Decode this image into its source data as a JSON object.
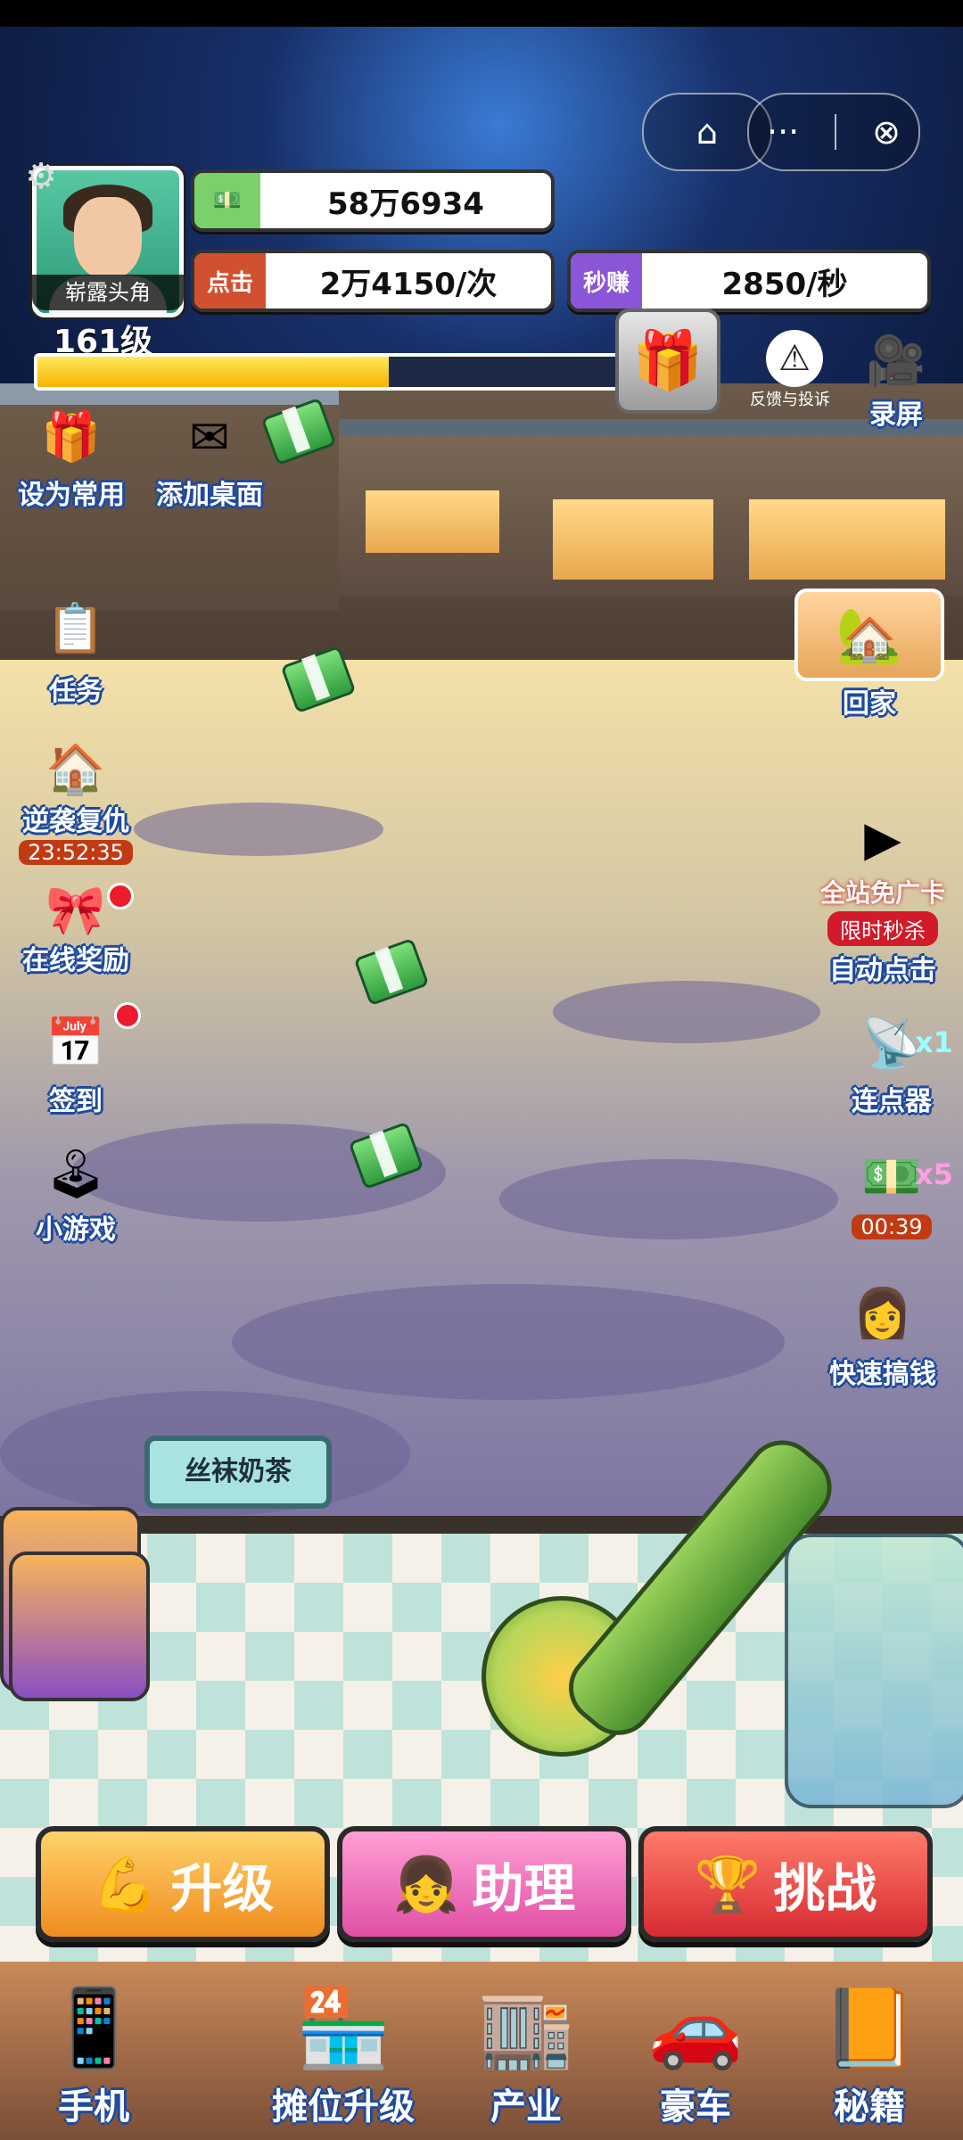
{
  "header": {
    "home_icon": "home-icon",
    "more_icon": "more-icon",
    "close_icon": "close-icon"
  },
  "player": {
    "name": "崭露头角",
    "cash": "58万6934",
    "click_tag": "点击",
    "click_value": "2万4150/次",
    "second_tag": "秒赚",
    "second_value": "2850/秒",
    "level": "161级",
    "level_progress": 0.58
  },
  "tools": {
    "feedback": "反馈与投诉",
    "record": "录屏"
  },
  "left_menu": [
    {
      "label": "设为常用",
      "icon": "gift-box-icon"
    },
    {
      "label": "添加桌面",
      "icon": "envelope-icon"
    },
    {
      "label": "任务",
      "icon": "clipboard-icon"
    },
    {
      "label": "逆袭复仇",
      "icon": "house-icon",
      "timer": "23:52:35"
    },
    {
      "label": "在线奖励",
      "icon": "gift-icon"
    },
    {
      "label": "签到",
      "icon": "calendar-icon"
    },
    {
      "label": "小游戏",
      "icon": "arcade-icon"
    }
  ],
  "right_menu": {
    "home": "回家",
    "ad_free": "全站免广卡",
    "flash_sale": "限时秒杀",
    "auto_click": "自动点击",
    "clicker": "连点器",
    "clicker_mult": "x1",
    "cash_bonus_mult": "x5",
    "cash_bonus_timer": "00:39",
    "fast_money": "快速搞钱"
  },
  "shop_sign": "丝袜奶茶",
  "actions": {
    "upgrade": "升级",
    "assistant": "助理",
    "challenge": "挑战"
  },
  "nav": [
    {
      "label": "手机",
      "icon": "phone-icon"
    },
    {
      "label": "摊位升级",
      "icon": "stall-icon"
    },
    {
      "label": "产业",
      "icon": "shop-icon"
    },
    {
      "label": "豪车",
      "icon": "car-icon"
    },
    {
      "label": "秘籍",
      "icon": "book-icon"
    }
  ],
  "colors": {
    "click_tag": "#d1502f",
    "second_tag": "#8a55d6",
    "upgrade": "#f29a21",
    "assistant": "#e04fa4",
    "challenge": "#e4373d"
  }
}
